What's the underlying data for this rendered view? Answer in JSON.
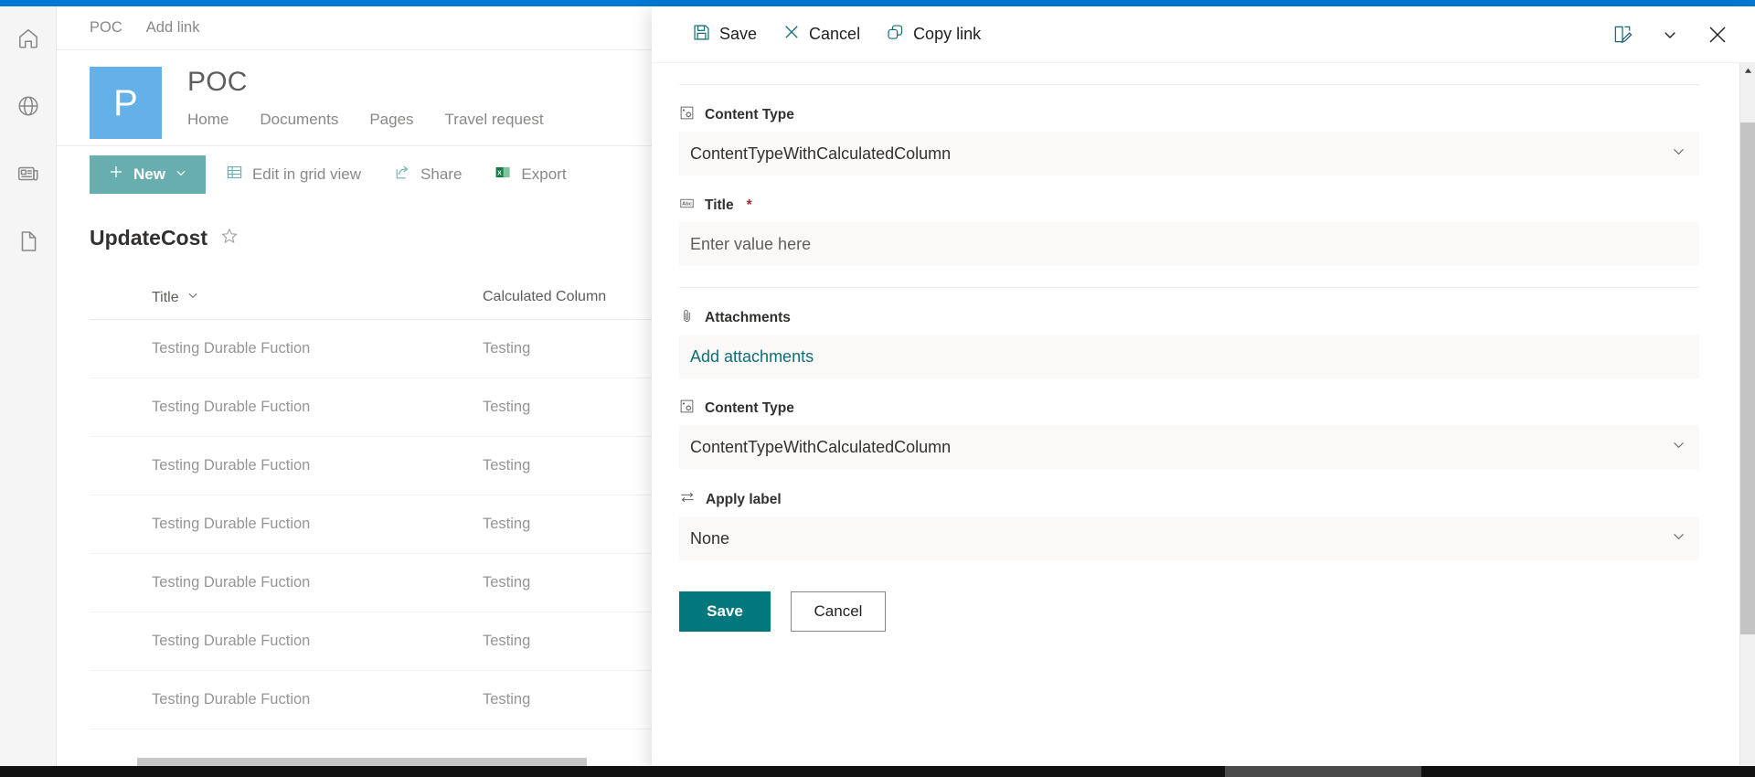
{
  "theme": {
    "suite_bar_color": "#0078d4",
    "site_logo_color": "#64b0e8",
    "new_button_color": "#69aeae",
    "save_button_color": "#03787c",
    "link_color": "#0f6e77",
    "required_color": "#a4262c"
  },
  "rail": {
    "items": [
      {
        "icon": "home-icon",
        "label": "Home"
      },
      {
        "icon": "globe-icon",
        "label": "Sites"
      },
      {
        "icon": "news-icon",
        "label": "News"
      },
      {
        "icon": "file-icon",
        "label": "Files"
      }
    ]
  },
  "top_nav": {
    "items": [
      {
        "label": "POC"
      },
      {
        "label": "Add link"
      }
    ]
  },
  "site": {
    "logo_letter": "P",
    "title": "POC",
    "tabs": [
      {
        "label": "Home"
      },
      {
        "label": "Documents"
      },
      {
        "label": "Pages"
      },
      {
        "label": "Travel request"
      }
    ]
  },
  "command_bar": {
    "new_label": "New",
    "items": [
      {
        "icon": "grid-icon",
        "label": "Edit in grid view"
      },
      {
        "icon": "share-icon",
        "label": "Share"
      },
      {
        "icon": "excel-icon",
        "label": "Export"
      }
    ]
  },
  "list": {
    "title": "UpdateCost",
    "favorite_icon": "star-icon",
    "columns": [
      {
        "label": "Title",
        "sortable": true
      },
      {
        "label": "Calculated Column"
      }
    ],
    "rows": [
      {
        "title": "Testing Durable Fuction",
        "calculated": "Testing"
      },
      {
        "title": "Testing Durable Fuction",
        "calculated": "Testing"
      },
      {
        "title": "Testing Durable Fuction",
        "calculated": "Testing"
      },
      {
        "title": "Testing Durable Fuction",
        "calculated": "Testing"
      },
      {
        "title": "Testing Durable Fuction",
        "calculated": "Testing"
      },
      {
        "title": "Testing Durable Fuction",
        "calculated": "Testing"
      },
      {
        "title": "Testing Durable Fuction",
        "calculated": "Testing"
      }
    ]
  },
  "panel": {
    "toolbar": {
      "save_label": "Save",
      "cancel_label": "Cancel",
      "copy_link_label": "Copy link",
      "edit_form_icon": "edit-form-icon",
      "more_icon": "chevron-down-icon",
      "close_icon": "close-icon"
    },
    "fields": [
      {
        "icon": "content-type-icon",
        "label": "Content Type",
        "value": "ContentTypeWithCalculatedColumn",
        "type": "dropdown",
        "required": false
      },
      {
        "icon": "abc-icon",
        "label": "Title",
        "value": "",
        "placeholder": "Enter value here",
        "type": "text",
        "required": true
      },
      {
        "icon": "paperclip-icon",
        "label": "Attachments",
        "value": "Add attachments",
        "type": "link",
        "required": false
      },
      {
        "icon": "content-type-icon",
        "label": "Content Type",
        "value": "ContentTypeWithCalculatedColumn",
        "type": "dropdown",
        "required": false
      },
      {
        "icon": "apply-label-icon",
        "label": "Apply label",
        "value": "None",
        "type": "dropdown",
        "required": false
      }
    ],
    "actions": {
      "save_label": "Save",
      "cancel_label": "Cancel"
    },
    "scrollbar": {
      "up_icon": "scroll-up-icon",
      "down_icon": "scroll-down-icon"
    }
  }
}
